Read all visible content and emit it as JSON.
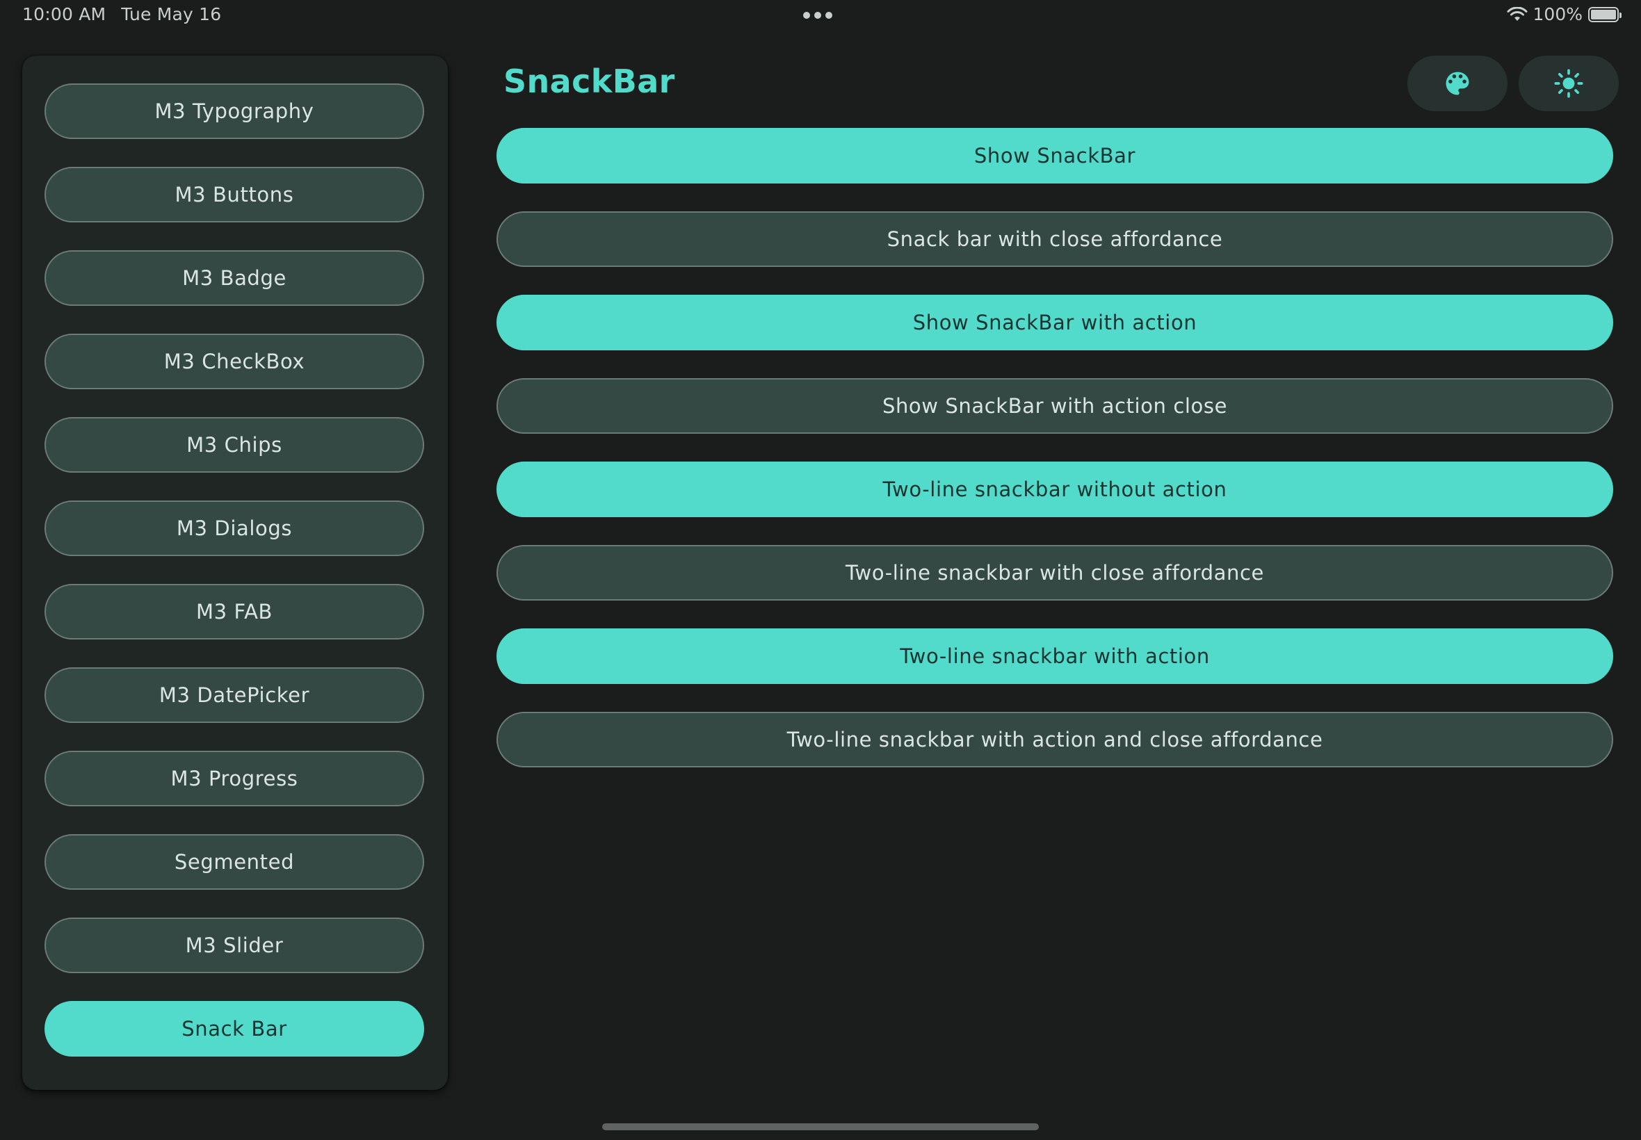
{
  "status_bar": {
    "time": "10:00 AM",
    "date": "Tue May 16",
    "battery": "100%",
    "wifi_icon": "wifi-icon",
    "battery_icon": "battery-icon"
  },
  "sidebar": {
    "items": [
      {
        "label": "M3 Typography",
        "active": false
      },
      {
        "label": "M3 Buttons",
        "active": false
      },
      {
        "label": "M3 Badge",
        "active": false
      },
      {
        "label": "M3 CheckBox",
        "active": false
      },
      {
        "label": "M3 Chips",
        "active": false
      },
      {
        "label": "M3 Dialogs",
        "active": false
      },
      {
        "label": "M3 FAB",
        "active": false
      },
      {
        "label": "M3 DatePicker",
        "active": false
      },
      {
        "label": "M3 Progress",
        "active": false
      },
      {
        "label": "Segmented",
        "active": false
      },
      {
        "label": "M3 Slider",
        "active": false
      },
      {
        "label": "Snack Bar",
        "active": true
      }
    ]
  },
  "header": {
    "title": "SnackBar",
    "palette_icon": "palette-icon",
    "theme_icon": "brightness-icon"
  },
  "main": {
    "buttons": [
      {
        "label": "Show SnackBar",
        "style": "filled"
      },
      {
        "label": "Snack bar with close affordance",
        "style": "tonal"
      },
      {
        "label": "Show SnackBar with action",
        "style": "filled"
      },
      {
        "label": "Show SnackBar with action close",
        "style": "tonal"
      },
      {
        "label": "Two-line snackbar without action",
        "style": "filled"
      },
      {
        "label": "Two-line snackbar with close affordance",
        "style": "tonal"
      },
      {
        "label": "Two-line snackbar with action",
        "style": "filled"
      },
      {
        "label": "Two-line snackbar with action and close affordance",
        "style": "tonal"
      }
    ]
  },
  "colors": {
    "background": "#1a1d1c",
    "accent": "#52dbca",
    "tonal": "#344844",
    "on_accent": "#163532"
  }
}
